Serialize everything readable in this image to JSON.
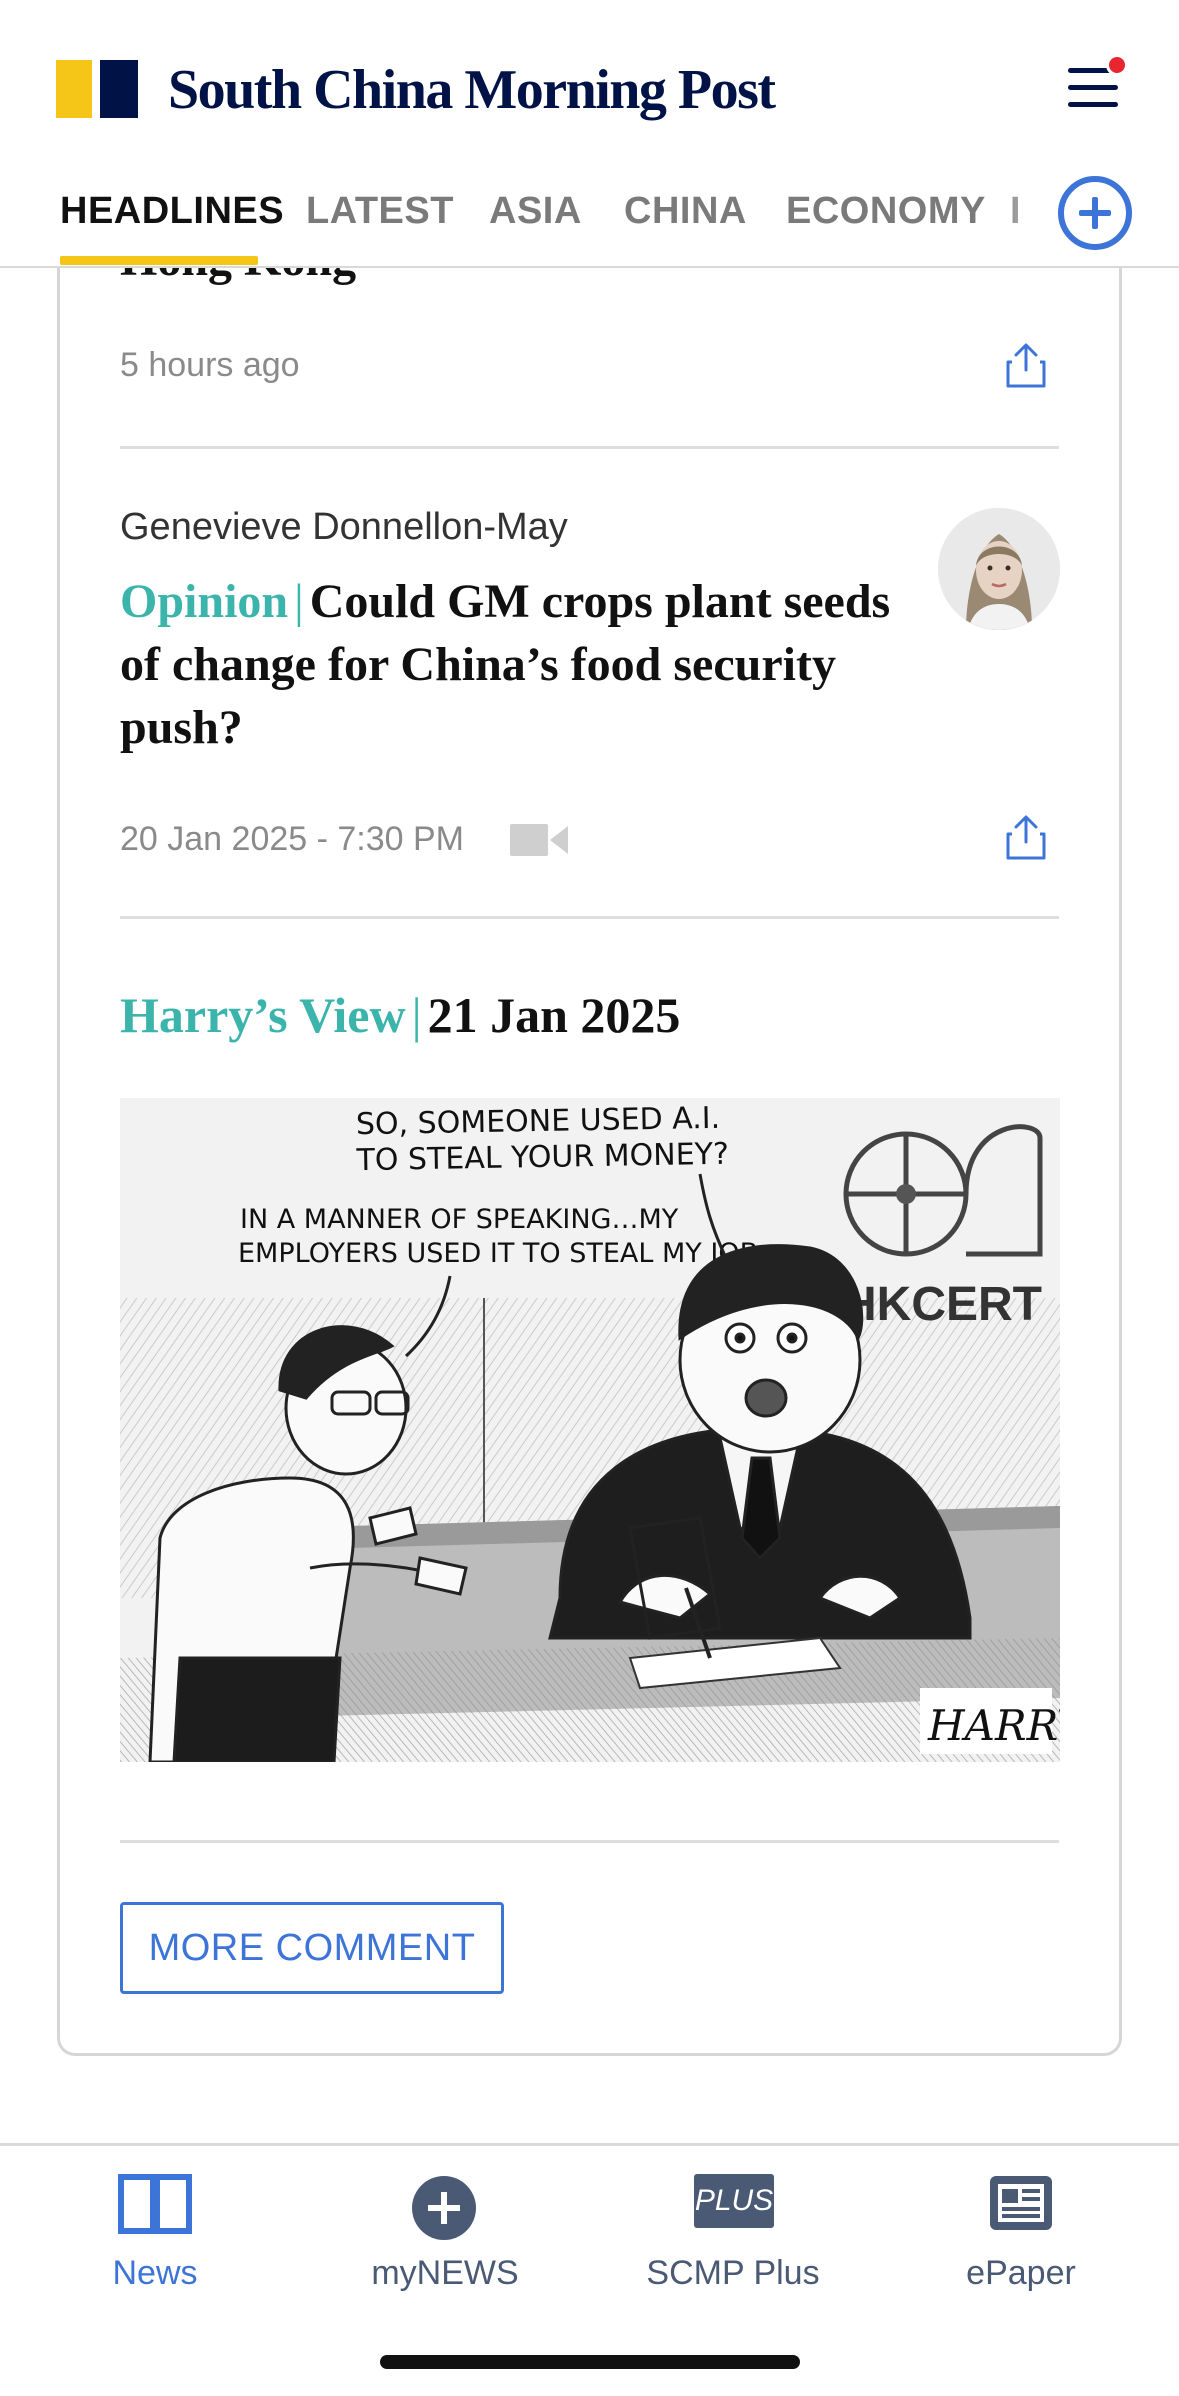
{
  "header": {
    "logo_text": "South China Morning Post",
    "notification_dot_color": "#e8262f",
    "brand_yellow": "#f5c518",
    "brand_navy": "#001246"
  },
  "tabs": [
    {
      "label": "HEADLINES",
      "active": true
    },
    {
      "label": "LATEST",
      "active": false
    },
    {
      "label": "ASIA",
      "active": false
    },
    {
      "label": "CHINA",
      "active": false
    },
    {
      "label": "ECONOMY",
      "active": false
    },
    {
      "label": "I",
      "active": false
    }
  ],
  "articles": [
    {
      "title_fragment": "Hong Kong",
      "time": "5 hours ago"
    },
    {
      "author": "Genevieve Donnellon-May",
      "section": "Opinion",
      "separator": "|",
      "title": "Could GM crops plant seeds of change for China’s food security push?",
      "time": "20 Jan 2025 - 7:30 PM",
      "has_video": true
    }
  ],
  "harrys_view": {
    "section": "Harry’s View",
    "separator": "|",
    "date": "21 Jan 2025",
    "cartoon": {
      "bubble_1": [
        "SO, SOMEONE USED A.I.",
        "TO STEAL YOUR MONEY?"
      ],
      "bubble_2": [
        "IN A MANNER OF SPEAKING…MY",
        "EMPLOYERS USED IT TO STEAL MY JOB"
      ],
      "sign": "HKCERT",
      "signature": "HARRY"
    }
  },
  "more_comment_label": "MORE COMMENT",
  "bottom_nav": [
    {
      "label": "News",
      "icon": "book-open-icon",
      "active": true
    },
    {
      "label": "myNEWS",
      "icon": "plus-circle-icon",
      "active": false
    },
    {
      "label": "SCMP Plus",
      "icon": "plus-badge-icon",
      "badge_text": "PLUS",
      "active": false
    },
    {
      "label": "ePaper",
      "icon": "newspaper-icon",
      "active": false
    }
  ],
  "colors": {
    "accent_blue": "#3d74d8",
    "teal": "#3bb4ac"
  }
}
